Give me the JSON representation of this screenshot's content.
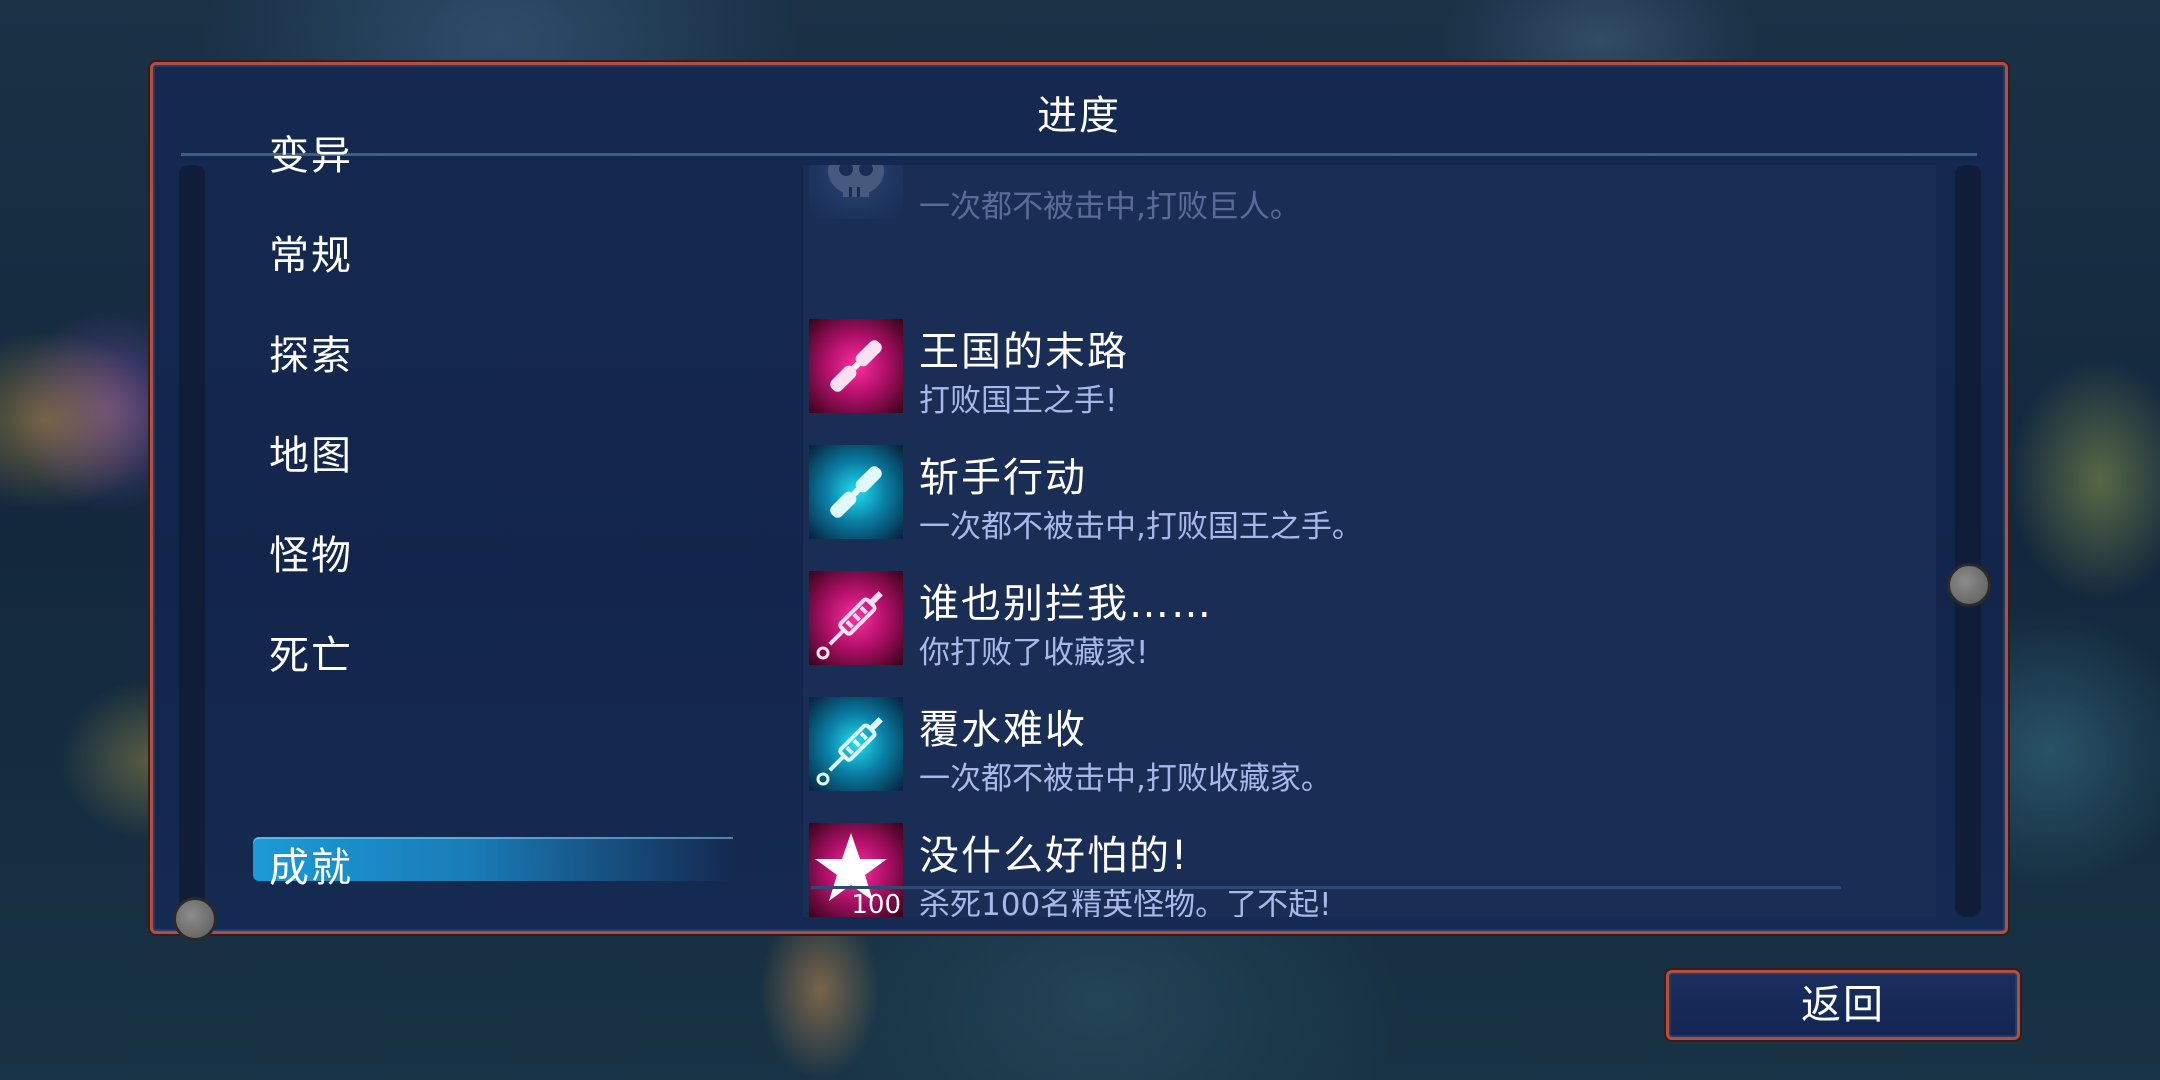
{
  "panel": {
    "title": "进度"
  },
  "categories": [
    {
      "label": "变异",
      "selected": false
    },
    {
      "label": "常规",
      "selected": false
    },
    {
      "label": "探索",
      "selected": false
    },
    {
      "label": "地图",
      "selected": false
    },
    {
      "label": "怪物",
      "selected": false
    },
    {
      "label": "死亡",
      "selected": false
    },
    {
      "label": "成就",
      "selected": true
    }
  ],
  "achievements": [
    {
      "title": "",
      "description": "一次都不被击中,打败巨人。",
      "icon": "skull-icon",
      "partially_scrolled": true
    },
    {
      "title": "王国的末路",
      "description": "打败国王之手!",
      "icon": "pink-blade-icon"
    },
    {
      "title": "斩手行动",
      "description": "一次都不被击中,打败国王之手。",
      "icon": "cyan-blade-icon"
    },
    {
      "title": "谁也别拦我……",
      "description": "你打败了收藏家!",
      "icon": "pink-syringe-icon"
    },
    {
      "title": "覆水难收",
      "description": "一次都不被击中,打败收藏家。",
      "icon": "cyan-syringe-icon"
    },
    {
      "title": "没什么好怕的!",
      "description": "杀死100名精英怪物。了不起!",
      "icon": "pink-star-icon",
      "icon_badge": "100"
    }
  ],
  "buttons": {
    "back_label": "返回"
  },
  "colors": {
    "panel_border": "#b0503e",
    "panel_bg": "#152950",
    "selected_tab": "#1b9bd6",
    "description_text": "#a8b8e8",
    "icon_pink": "#ff2fa0",
    "icon_cyan": "#1fe0f0"
  }
}
